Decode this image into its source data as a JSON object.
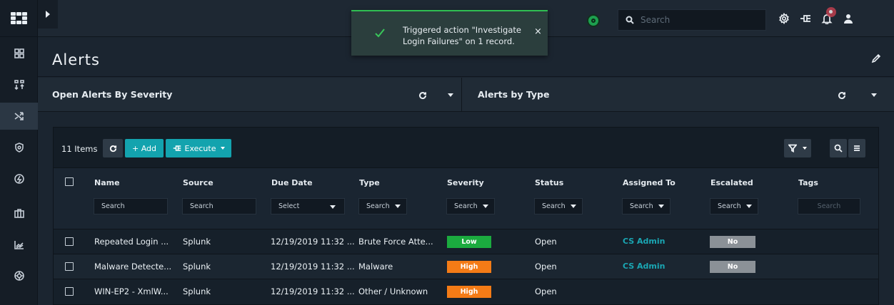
{
  "app": {
    "logo": "brand-logo"
  },
  "rail": [
    {
      "icon": "dashboard-icon"
    },
    {
      "icon": "queue-icon"
    },
    {
      "icon": "shuffle-icon",
      "active": true
    },
    {
      "icon": "shield-icon"
    },
    {
      "icon": "bolt-icon"
    },
    {
      "icon": "briefcase-icon"
    },
    {
      "icon": "chart-icon"
    },
    {
      "icon": "settings-wheel-icon"
    }
  ],
  "topbar": {
    "search_placeholder": "Search",
    "status_color": "#1d9f4f"
  },
  "toast": {
    "message": "Triggered action \"Investigate Login Failures\" on 1 record.",
    "close": "×",
    "accent": "#2fbf52"
  },
  "page": {
    "title": "Alerts"
  },
  "widgets": [
    {
      "title": "Open Alerts By Severity"
    },
    {
      "title": "Alerts by Type"
    }
  ],
  "toolbar": {
    "count": "11 Items",
    "add_label": "+ Add",
    "execute_label": "Execute"
  },
  "columns": [
    {
      "label": "Name",
      "filter": "Search",
      "filter_type": "text"
    },
    {
      "label": "Source",
      "filter": "Search",
      "filter_type": "text"
    },
    {
      "label": "Due Date",
      "filter": "Select",
      "filter_type": "select"
    },
    {
      "label": "Type",
      "filter": "Search",
      "filter_type": "dropdown"
    },
    {
      "label": "Severity",
      "filter": "Search",
      "filter_type": "dropdown"
    },
    {
      "label": "Status",
      "filter": "Search",
      "filter_type": "dropdown"
    },
    {
      "label": "Assigned To",
      "filter": "Search",
      "filter_type": "dropdown"
    },
    {
      "label": "Escalated",
      "filter": "Search",
      "filter_type": "dropdown"
    },
    {
      "label": "Tags",
      "filter": "Search",
      "filter_type": "placeholder"
    }
  ],
  "rows": [
    {
      "name": "Repeated Login ...",
      "source": "Splunk",
      "due": "12/19/2019 11:32 ...",
      "type": "Brute Force Atte...",
      "severity": "Low",
      "severity_color": "#1bab3f",
      "status": "Open",
      "assigned": "CS Admin",
      "escalated": "No"
    },
    {
      "name": "Malware Detecte...",
      "source": "Splunk",
      "due": "12/19/2019 11:32 ...",
      "type": "Malware",
      "severity": "High",
      "severity_color": "#f47b16",
      "status": "Open",
      "assigned": "CS Admin",
      "escalated": "No"
    },
    {
      "name": "WIN-EP2 - XmlW...",
      "source": "Splunk",
      "due": "12/19/2019 11:32 ...",
      "type": "Other / Unknown",
      "severity": "High",
      "severity_color": "#f47b16",
      "status": "Open",
      "assigned": "",
      "escalated": ""
    }
  ]
}
